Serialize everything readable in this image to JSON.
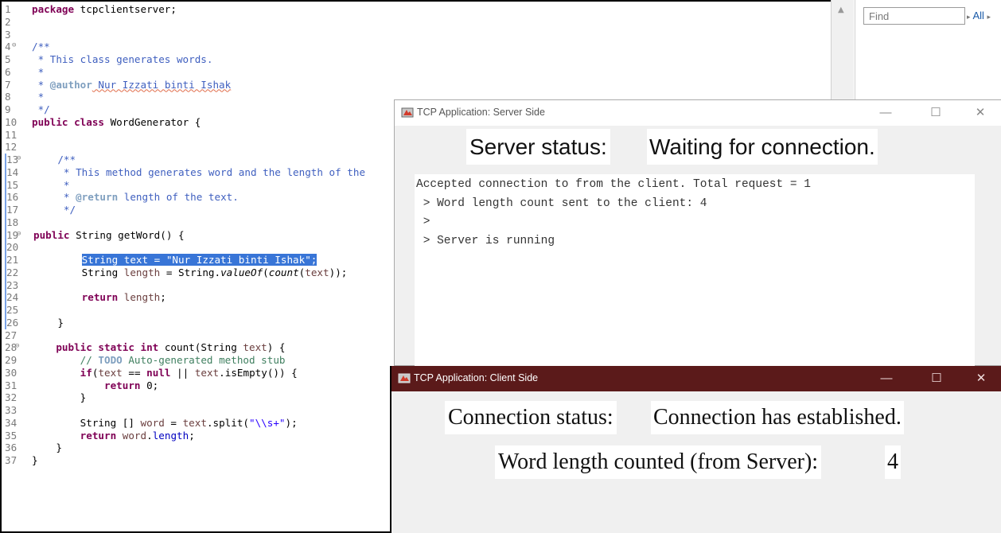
{
  "editor": {
    "package_kw": "package",
    "package_name": " tcpclientserver;",
    "javadoc_class": [
      "/**",
      " * This class generates words.",
      " *",
      " * ",
      "@author",
      " Nur Izzati binti Ishak",
      " *",
      " */"
    ],
    "class_decl": [
      "public class",
      " WordGenerator {"
    ],
    "javadoc_method": [
      "/**",
      " * This method generates word and the length of the",
      " *",
      " * ",
      "@return",
      " length of the text.",
      " */"
    ],
    "method_getword": [
      "public",
      " String getWord() {"
    ],
    "line21": "String text = \"Nur Izzati binti Ishak\";",
    "line22_a": "String ",
    "line22_b": "length",
    "line22_c": " = String.",
    "line22_d": "valueOf",
    "line22_e": "(",
    "line22_f": "count",
    "line22_g": "(",
    "line22_h": "text",
    "line22_i": "));",
    "line24_kw": "return",
    "line24_var": " length",
    "line24_end": ";",
    "brace_close": "}",
    "line28": [
      "public static int",
      " count(String ",
      "text",
      ") {"
    ],
    "line29": [
      "// ",
      "TODO",
      " Auto-generated method stub"
    ],
    "line30": [
      "if",
      "(",
      "text",
      " == ",
      "null",
      " || ",
      "text",
      ".isEmpty()) {"
    ],
    "line31": [
      "return",
      " 0;"
    ],
    "line34": [
      "String [] ",
      "word",
      " = ",
      "text",
      ".split(",
      "\"\\\\s+\"",
      ");"
    ],
    "line35": [
      "return",
      " ",
      "word",
      ".",
      "length",
      ";"
    ],
    "line_numbers": [
      "1",
      "2",
      "3",
      "4",
      "5",
      "6",
      "7",
      "8",
      "9",
      "10",
      "11",
      "12",
      "13",
      "14",
      "15",
      "16",
      "17",
      "18",
      "19",
      "20",
      "21",
      "22",
      "23",
      "24",
      "25",
      "26",
      "27",
      "28",
      "29",
      "30",
      "31",
      "32",
      "33",
      "34",
      "35",
      "36",
      "37"
    ]
  },
  "find": {
    "placeholder": "Find",
    "all_label": "All"
  },
  "server_window": {
    "title": "TCP Application: Server Side",
    "status_label": "Server status:",
    "status_value": "Waiting for connection.",
    "console_lines": [
      "Accepted connection to from the client. Total request = 1",
      " > Word length count sent to the client: 4",
      " >",
      " > Server is running"
    ]
  },
  "client_window": {
    "title": "TCP Application: Client Side",
    "status_label": "Connection status:",
    "status_value": "Connection has established.",
    "word_length_label": "Word length counted (from Server):",
    "word_length_value": "4"
  },
  "window_controls": {
    "minimize": "—",
    "maximize": "☐",
    "close": "✕"
  },
  "colors": {
    "client_titlebar": "#5b1a1a",
    "selection": "#3875d7",
    "keyword": "#7f0055",
    "javadoc": "#3f5fbf"
  }
}
